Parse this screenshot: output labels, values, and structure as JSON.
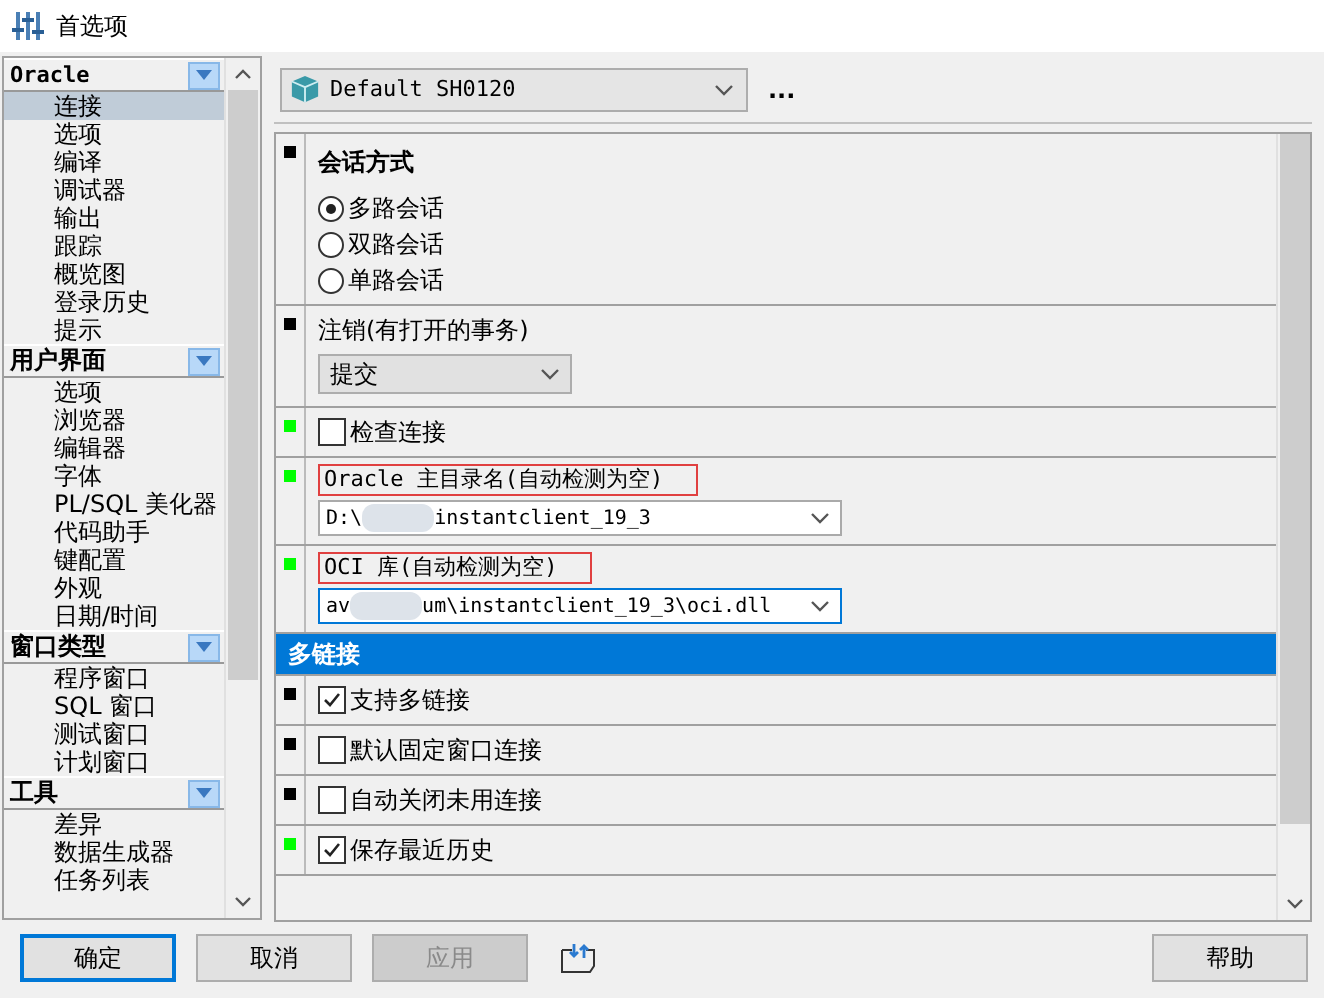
{
  "window": {
    "title": "首选项"
  },
  "sidebar": {
    "groups": [
      {
        "title": "Oracle",
        "items": [
          {
            "label": "连接",
            "selected": true
          },
          {
            "label": "选项",
            "selected": false
          },
          {
            "label": "编译",
            "selected": false
          },
          {
            "label": "调试器",
            "selected": false
          },
          {
            "label": "输出",
            "selected": false
          },
          {
            "label": "跟踪",
            "selected": false
          },
          {
            "label": "概览图",
            "selected": false
          },
          {
            "label": "登录历史",
            "selected": false
          },
          {
            "label": "提示",
            "selected": false
          }
        ]
      },
      {
        "title": "用户界面",
        "items": [
          {
            "label": "选项",
            "selected": false
          },
          {
            "label": "浏览器",
            "selected": false
          },
          {
            "label": "编辑器",
            "selected": false
          },
          {
            "label": "字体",
            "selected": false
          },
          {
            "label": "PL/SQL 美化器",
            "selected": false
          },
          {
            "label": "代码助手",
            "selected": false
          },
          {
            "label": "键配置",
            "selected": false
          },
          {
            "label": "外观",
            "selected": false
          },
          {
            "label": "日期/时间",
            "selected": false
          }
        ]
      },
      {
        "title": "窗口类型",
        "items": [
          {
            "label": "程序窗口",
            "selected": false
          },
          {
            "label": "SQL 窗口",
            "selected": false
          },
          {
            "label": "测试窗口",
            "selected": false
          },
          {
            "label": "计划窗口",
            "selected": false
          }
        ]
      },
      {
        "title": "工具",
        "items": [
          {
            "label": "差异",
            "selected": false
          },
          {
            "label": "数据生成器",
            "selected": false
          },
          {
            "label": "任务列表",
            "selected": false
          }
        ]
      }
    ]
  },
  "profile": {
    "value": "Default SH0120",
    "more": "..."
  },
  "settings": [
    {
      "kind": "radio-group",
      "color": "#000000",
      "title": "会话方式",
      "options": [
        {
          "label": "多路会话",
          "selected": true
        },
        {
          "label": "双路会话",
          "selected": false
        },
        {
          "label": "单路会话",
          "selected": false
        }
      ]
    },
    {
      "kind": "select",
      "color": "#000000",
      "label": "注销(有打开的事务)",
      "value": "提交"
    },
    {
      "kind": "checkbox",
      "color": "#00ff00",
      "label": "检查连接",
      "checked": false
    },
    {
      "kind": "path",
      "color": "#00ff00",
      "label": "Oracle 主目录名(自动检测为空)",
      "highlighted": true,
      "value_start": "D:\\",
      "value_end": "instantclient_19_3",
      "focused": false
    },
    {
      "kind": "path",
      "color": "#00ff00",
      "label": "OCI 库(自动检测为空)",
      "highlighted": true,
      "value_start": "av",
      "value_end": "um\\instantclient_19_3\\oci.dll",
      "focused": true
    },
    {
      "kind": "header",
      "label": "多链接"
    },
    {
      "kind": "checkbox",
      "color": "#000000",
      "label": "支持多链接",
      "checked": true
    },
    {
      "kind": "checkbox",
      "color": "#000000",
      "label": "默认固定窗口连接",
      "checked": false
    },
    {
      "kind": "checkbox",
      "color": "#000000",
      "label": "自动关闭未用连接",
      "checked": false
    },
    {
      "kind": "checkbox",
      "color": "#00ff00",
      "label": "保存最近历史",
      "checked": true
    }
  ],
  "buttons": [
    {
      "label": "确定",
      "default": true,
      "disabled": false
    },
    {
      "label": "取消",
      "default": false,
      "disabled": false
    },
    {
      "label": "应用",
      "default": false,
      "disabled": true
    },
    {
      "label": "帮助",
      "default": false,
      "disabled": false
    }
  ]
}
